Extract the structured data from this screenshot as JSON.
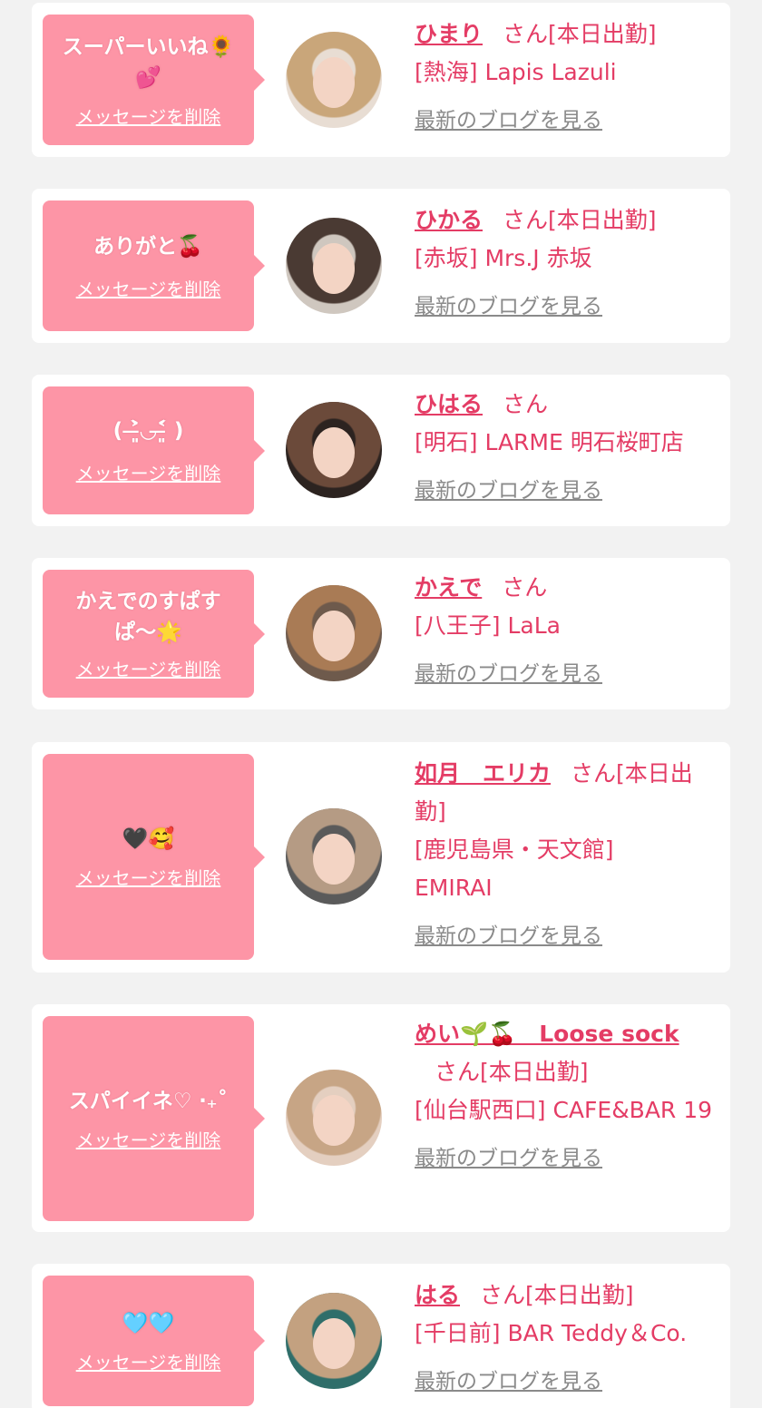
{
  "colors": {
    "accent": "#e43c65",
    "bubble": "#fd95a6",
    "background": "#f2f2f2",
    "link_gray": "#8a8a8a"
  },
  "labels": {
    "delete_message": "メッセージを削除",
    "view_blog": "最新のブログを見る",
    "honorific": "さん"
  },
  "items": [
    {
      "message": "スーパーいいね🌻\n💕",
      "name": "ひまり",
      "status": "[本日出勤]",
      "shop": "[熱海] Lapis Lazuli",
      "avatar_hair": "#c9a67a",
      "avatar_bg": "#e8ddd3"
    },
    {
      "message": "ありがと🍒",
      "name": "ひかる",
      "status": "[本日出勤]",
      "shop": "[赤坂] Mrs.J 赤坂",
      "avatar_hair": "#4a3a33",
      "avatar_bg": "#cfc7bf"
    },
    {
      "message": "( ˃̶͈̀◡˂̶͈́ )",
      "name": "ひはる",
      "status": "",
      "shop": "[明石] LARME 明石桜町店",
      "avatar_hair": "#6b4a3a",
      "avatar_bg": "#2c2320"
    },
    {
      "message": "かえでのすぱす\nぱ〜🌟",
      "name": "かえで",
      "status": "",
      "shop": "[八王子] LaLa",
      "avatar_hair": "#a97b55",
      "avatar_bg": "#6e5a4c"
    },
    {
      "message": "🖤🥰",
      "name": "如月　エリカ",
      "status": "[本日出勤]",
      "shop": "[鹿児島県・天文館] EMIRAI",
      "avatar_hair": "#b59b84",
      "avatar_bg": "#5a5a5a"
    },
    {
      "message": "スパイイネ♡ ‧₊˚",
      "name": "めい🌱🍒　Loose sock",
      "status": "[本日出勤]",
      "shop": "[仙台駅西口] CAFE&BAR 19",
      "avatar_hair": "#c7a585",
      "avatar_bg": "#e4cfc0"
    },
    {
      "message": "🩵🩵",
      "name": "はる",
      "status": "[本日出勤]",
      "shop": "[千日前] BAR Teddy＆Co.",
      "avatar_hair": "#c3a180",
      "avatar_bg": "#2f6e6a"
    }
  ]
}
